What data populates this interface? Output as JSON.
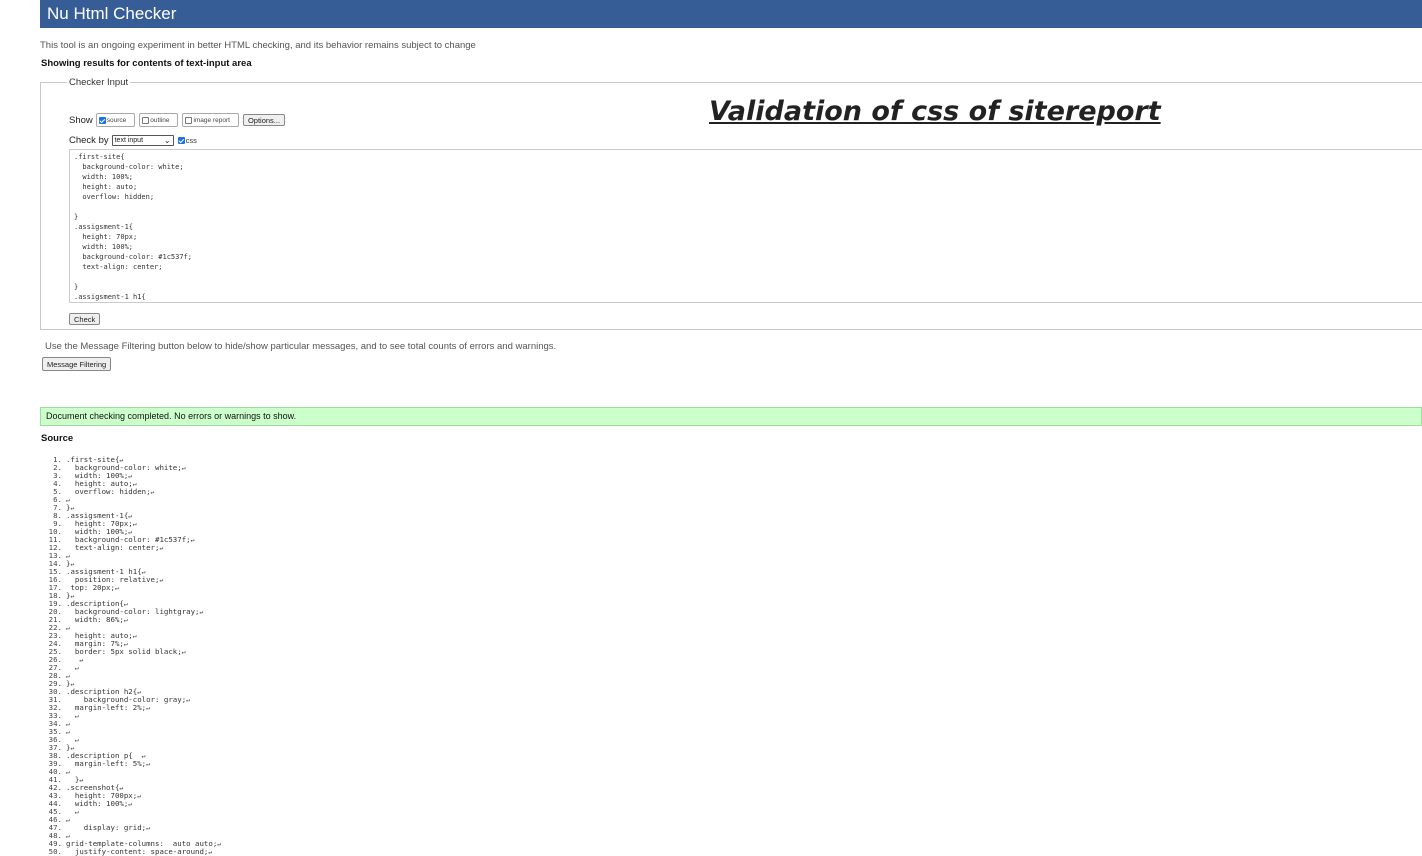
{
  "header": {
    "title": "Nu Html Checker"
  },
  "intro": "This tool is an ongoing experiment in better HTML checking, and its behavior remains subject to change",
  "results_heading": "Showing results for contents of text-input area",
  "checker": {
    "legend": "Checker Input",
    "show_label": "Show",
    "show_options": [
      {
        "label": "source",
        "checked": true
      },
      {
        "label": "outline",
        "checked": false
      },
      {
        "label": "image report",
        "checked": false
      }
    ],
    "options_button": "Options...",
    "check_by_label": "Check by",
    "check_by_value": "text input",
    "css_option": {
      "label": "css",
      "checked": true
    },
    "textarea_lines": [
      ".first-site{",
      "  background-color: white;",
      "  width: 100%;",
      "  height: auto;",
      "  overflow: hidden;",
      "",
      "}",
      ".assigsment-1{",
      "  height: 70px;",
      "  width: 100%;",
      "  background-color: #1c537f;",
      "  text-align: center;",
      "",
      "}",
      ".assigsment-1 h1{"
    ],
    "check_button": "Check"
  },
  "annotation": "Validation of css of sitereport",
  "filter": {
    "text": "Use the Message Filtering button below to hide/show particular messages, and to see total counts of errors and warnings.",
    "button": "Message Filtering"
  },
  "success_message": "Document checking completed. No errors or warnings to show.",
  "source_heading": "Source",
  "source_lines": [
    ".first-site{",
    "  background-color: white;",
    "  width: 100%;",
    "  height: auto;",
    "  overflow: hidden;",
    "",
    "}",
    ".assigsment-1{",
    "  height: 70px;",
    "  width: 100%;",
    "  background-color: #1c537f;",
    "  text-align: center;",
    "",
    "}",
    ".assigsment-1 h1{",
    "  position: relative;",
    " top: 20px;",
    "}",
    ".description{",
    "  background-color: lightgray;",
    "  width: 86%;",
    "",
    "  height: auto;",
    "  margin: 7%;",
    "  border: 5px solid black;",
    "   ",
    "  ",
    "",
    "}",
    ".description h2{",
    "    background-color: gray;",
    "  margin-left: 2%;",
    "  ",
    "",
    "",
    "  ",
    "}",
    ".description p{  ",
    "  margin-left: 5%;",
    "",
    "  }",
    ".screenshot{",
    "  height: 700px;",
    "  width: 100%;",
    "  ",
    "",
    "    display: grid;",
    "",
    "grid-template-columns:  auto auto;",
    "  justify-content: space-around;"
  ]
}
